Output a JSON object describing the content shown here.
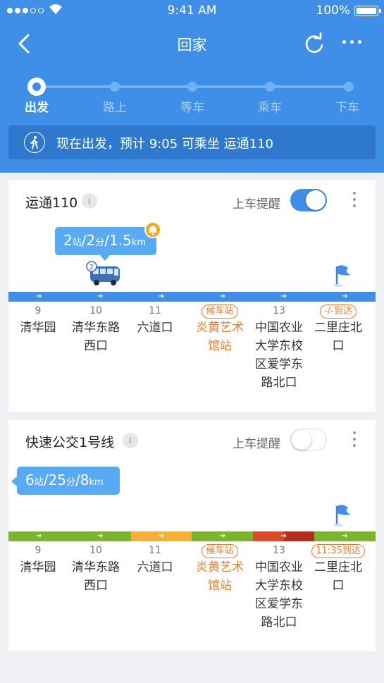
{
  "status_bar": {
    "time": "9:41 AM",
    "battery": "100%"
  },
  "nav": {
    "title": "回家"
  },
  "steps": [
    "出发",
    "路上",
    "等车",
    "乘车",
    "下车"
  ],
  "banner": {
    "text": "现在出发，预计 9:05 可乘坐 运通110"
  },
  "colors": {
    "primary": "#3f8fe8",
    "accent": "#f07a2a",
    "green": "#7cb32f",
    "yellow": "#f5b03a",
    "red": "#d94b2b",
    "dark_red": "#b42e1b"
  },
  "cards": [
    {
      "title": "运通110",
      "remind_label": "上车提醒",
      "remind_on": true,
      "bubble": {
        "stops": "2",
        "stops_unit": "站",
        "minutes": "2",
        "minutes_unit": "分",
        "distance": "1.5",
        "distance_unit": "km"
      },
      "bus_badge": "2",
      "segments": [
        "blue",
        "blue",
        "blue",
        "blue",
        "blue",
        "blue"
      ],
      "stops": [
        {
          "no": "9",
          "badge": "",
          "name": "清华园",
          "highlight": false
        },
        {
          "no": "10",
          "badge": "",
          "name": "清华东路西口",
          "highlight": false
        },
        {
          "no": "11",
          "badge": "",
          "name": "六道口",
          "highlight": false
        },
        {
          "no": "",
          "badge": "候车站",
          "name": "炎黄艺术馆站",
          "highlight": true
        },
        {
          "no": "13",
          "badge": "",
          "name": "中国农业大学东校区爱学东路北口",
          "highlight": false
        },
        {
          "no": "",
          "badge": "-/-到达",
          "name": "二里庄北口",
          "highlight": false
        }
      ]
    },
    {
      "title": "快速公交1号线",
      "remind_label": "上车提醒",
      "remind_on": false,
      "bubble": {
        "stops": "6",
        "stops_unit": "站",
        "minutes": "25",
        "minutes_unit": "分",
        "distance": "8",
        "distance_unit": "km"
      },
      "segments": [
        "green",
        "green",
        "yellow",
        "green",
        "red",
        "green"
      ],
      "stops": [
        {
          "no": "9",
          "badge": "",
          "name": "清华园",
          "highlight": false
        },
        {
          "no": "10",
          "badge": "",
          "name": "清华东路西口",
          "highlight": false
        },
        {
          "no": "11",
          "badge": "",
          "name": "六道口",
          "highlight": false
        },
        {
          "no": "",
          "badge": "候车站",
          "name": "炎黄艺术馆站",
          "highlight": true
        },
        {
          "no": "13",
          "badge": "",
          "name": "中国农业大学东校区爱学东路北口",
          "highlight": false
        },
        {
          "no": "",
          "badge": "11:35到达",
          "name": "二里庄北口",
          "highlight": false
        }
      ]
    }
  ]
}
